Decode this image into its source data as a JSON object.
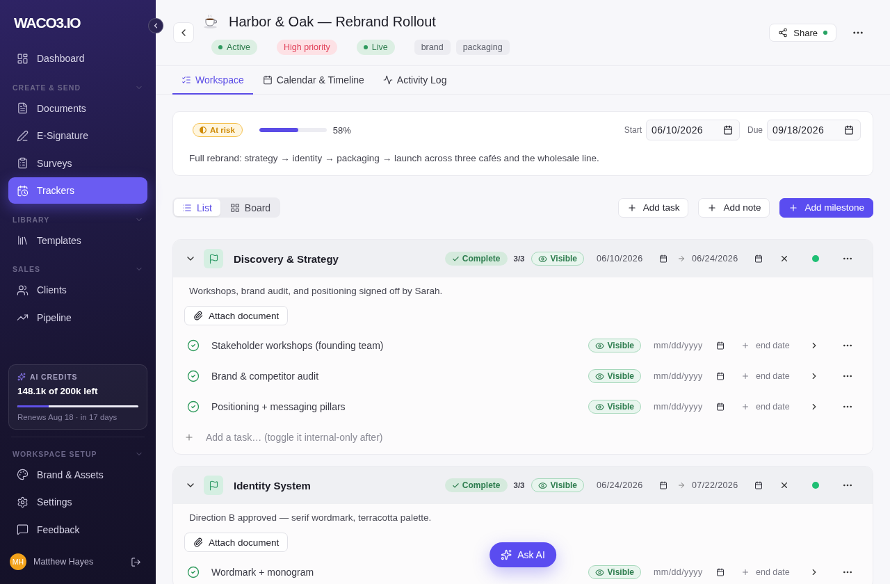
{
  "sidebar": {
    "logo": "WACO3.IO",
    "groups": [
      {
        "items": [
          {
            "label": "Dashboard",
            "selected": false
          }
        ]
      },
      {
        "heading": "CREATE & SEND",
        "expanded": true,
        "items": [
          {
            "label": "Documents",
            "selected": false
          },
          {
            "label": "E-Signature",
            "selected": false
          },
          {
            "label": "Surveys",
            "selected": false
          },
          {
            "label": "Trackers",
            "selected": true
          }
        ]
      },
      {
        "heading": "LIBRARY",
        "expanded": true,
        "items": [
          {
            "label": "Templates",
            "selected": false
          }
        ]
      },
      {
        "heading": "SALES",
        "expanded": true,
        "items": [
          {
            "label": "Clients",
            "selected": false
          },
          {
            "label": "Pipeline",
            "selected": false
          }
        ]
      }
    ],
    "credits": {
      "title": "AI CREDITS",
      "amount": "148.1k of 200k left",
      "level": 0.26,
      "renewal": "Renews Aug 18 · in 17 days"
    },
    "setup": {
      "heading": "WORKSPACE SETUP",
      "expanded": true,
      "items": [
        {
          "label": "Brand & Assets",
          "selected": false
        },
        {
          "label": "Settings",
          "selected": false
        },
        {
          "label": "Feedback",
          "selected": false
        }
      ]
    },
    "user": {
      "initials": "MH",
      "name": "Matthew Hayes"
    }
  },
  "header": {
    "title": "Harbor & Oak — Rebrand Rollout",
    "badges": [
      {
        "label": "Active",
        "kind": "status"
      },
      {
        "label": "High priority",
        "kind": "priority"
      },
      {
        "label": "Live",
        "kind": "status"
      },
      {
        "label": "brand",
        "kind": "tag"
      },
      {
        "label": "packaging",
        "kind": "tag"
      }
    ],
    "share": {
      "label": "Share",
      "active": true
    }
  },
  "tabs": [
    {
      "label": "Workspace",
      "selected": true
    },
    {
      "label": "Calendar & Timeline",
      "selected": false
    },
    {
      "label": "Activity Log",
      "selected": false
    }
  ],
  "summary": {
    "health": {
      "label": "At risk",
      "kind": "warning"
    },
    "progress": {
      "level": 0.58,
      "reading": "58%"
    },
    "start": {
      "label": "Start",
      "value": "06/10/2026"
    },
    "due": {
      "label": "Due",
      "value": "09/18/2026"
    },
    "description": "Full rebrand: strategy → identity → packaging → launch across three cafés and the wholesale line."
  },
  "toolbar": {
    "views": [
      {
        "label": "List",
        "selected": true
      },
      {
        "label": "Board",
        "selected": false
      }
    ],
    "actions": [
      {
        "label": "Add task",
        "kind": "secondary"
      },
      {
        "label": "Add note",
        "kind": "secondary"
      },
      {
        "label": "Add milestone",
        "kind": "primary"
      }
    ]
  },
  "milestones": [
    {
      "title": "Discovery & Strategy",
      "expanded": true,
      "status": {
        "label": "Complete",
        "kind": "complete"
      },
      "count": "3/3",
      "visibility": {
        "label": "Visible",
        "visible": true
      },
      "start": "06/10/2026",
      "end": "06/24/2026",
      "color": "#1fbf74",
      "description": "Workshops, brand audit, and positioning signed off by Sarah.",
      "attach": "Attach document",
      "tasks": [
        {
          "title": "Stakeholder workshops (founding team)",
          "checked": true,
          "visibility": {
            "label": "Visible",
            "visible": true
          },
          "date": {
            "placeholder": "mm/dd/yyyy"
          },
          "end_date": "end date"
        },
        {
          "title": "Brand & competitor audit",
          "checked": true,
          "visibility": {
            "label": "Visible",
            "visible": true
          },
          "date": {
            "placeholder": "mm/dd/yyyy"
          },
          "end_date": "end date"
        },
        {
          "title": "Positioning + messaging pillars",
          "checked": true,
          "visibility": {
            "label": "Visible",
            "visible": true
          },
          "date": {
            "placeholder": "mm/dd/yyyy"
          },
          "end_date": "end date"
        }
      ],
      "new_task": {
        "placeholder": "Add a task… (toggle it internal-only after)"
      }
    },
    {
      "title": "Identity System",
      "expanded": true,
      "status": {
        "label": "Complete",
        "kind": "complete"
      },
      "count": "3/3",
      "visibility": {
        "label": "Visible",
        "visible": true
      },
      "start": "06/24/2026",
      "end": "07/22/2026",
      "color": "#1fbf74",
      "description": "Direction B approved — serif wordmark, terracotta palette.",
      "attach": "Attach document",
      "tasks": [
        {
          "title": "Wordmark + monogram",
          "checked": true,
          "visibility": {
            "label": "Visible",
            "visible": true
          },
          "date": {
            "placeholder": "mm/dd/yyyy"
          },
          "end_date": "end date"
        }
      ]
    }
  ],
  "assistant": {
    "label": "Ask AI"
  }
}
